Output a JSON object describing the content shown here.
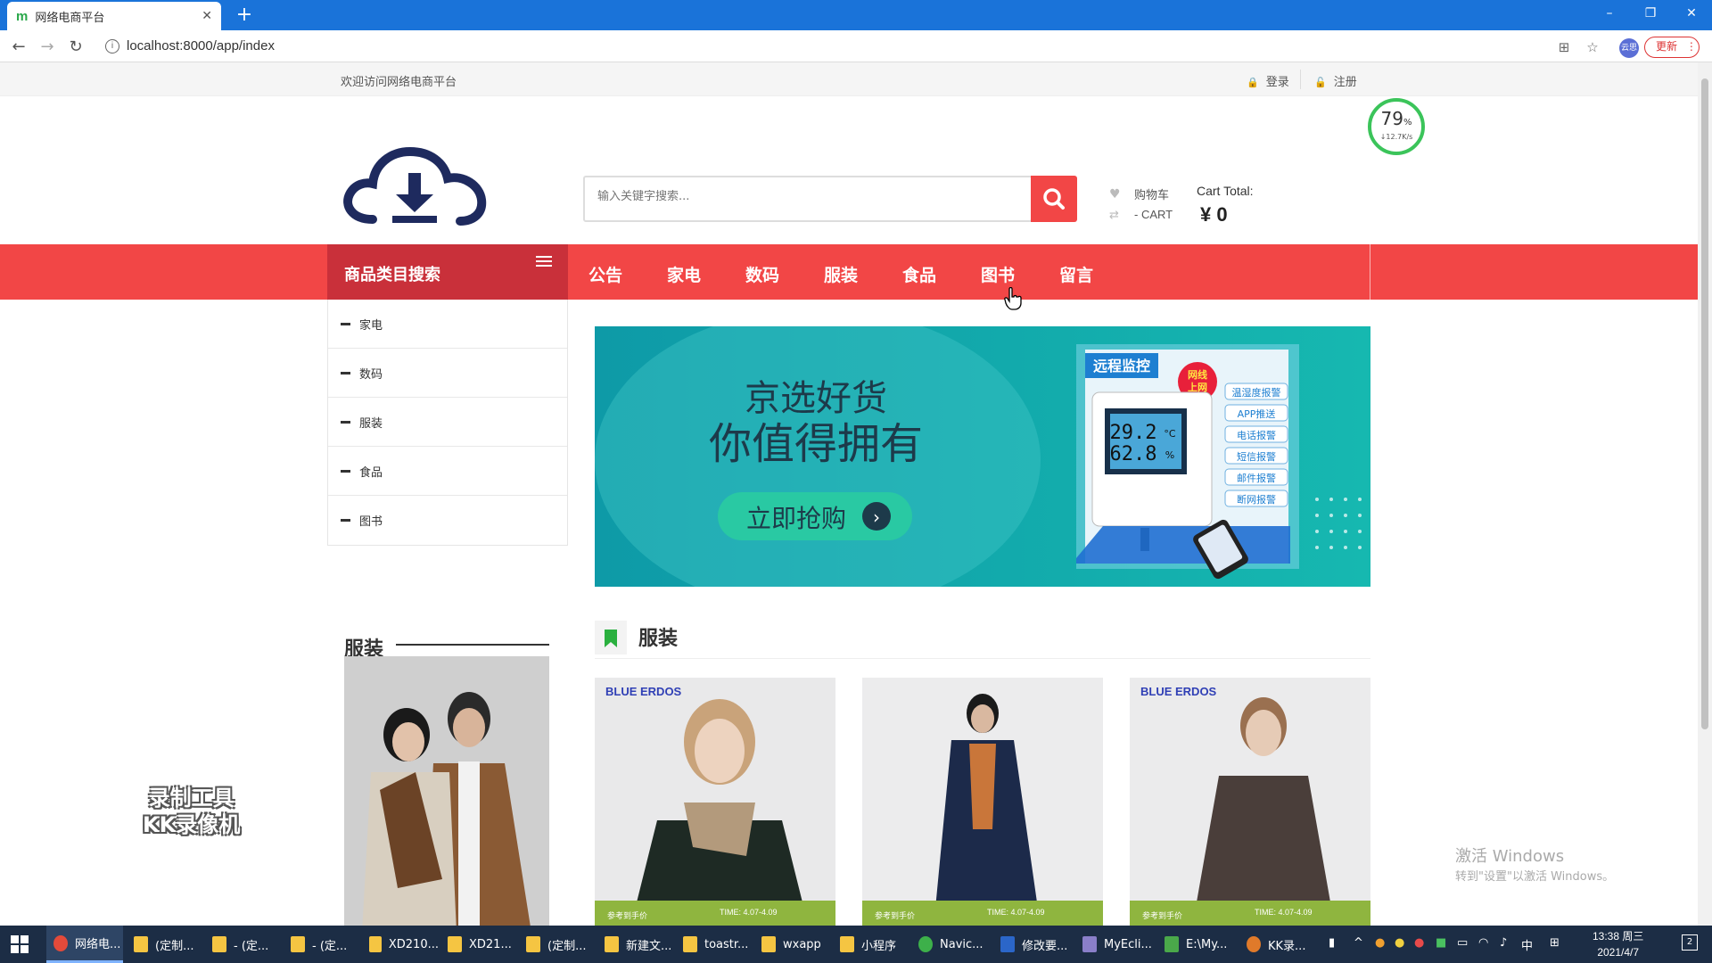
{
  "browser": {
    "tab_title": "网络电商平台",
    "tab_favicon": "m",
    "new_tab": "+",
    "url": "localhost:8000/app/index",
    "update_label": "更新",
    "profile_text": "云思",
    "window_controls": {
      "minimize": "–",
      "restore": "❐",
      "close": "✕"
    }
  },
  "topbar": {
    "welcome": "欢迎访问网络电商平台",
    "login": "登录",
    "register": "注册"
  },
  "speed_widget": {
    "percent": "79",
    "percent_unit": "%",
    "rate": "↓12.7K/s"
  },
  "search": {
    "placeholder": "输入关键字搜索..."
  },
  "cart": {
    "label": "购物车",
    "label_en": "- CART",
    "total_label": "Cart Total:",
    "total": "¥ 0"
  },
  "category_header": "商品类目搜索",
  "nav": [
    "公告",
    "家电",
    "数码",
    "服装",
    "食品",
    "图书",
    "留言"
  ],
  "categories": [
    "家电",
    "数码",
    "服装",
    "食品",
    "图书"
  ],
  "banner": {
    "headline1": "京选好货",
    "headline2": "你值得拥有",
    "cta": "立即抢购",
    "tag": "远程监控",
    "tag2a": "网线",
    "tag2b": "上网",
    "reading1": "29.2",
    "reading1_unit": "°C",
    "reading2": "62.8",
    "reading2_unit": "%",
    "features": [
      "温湿度报警",
      "APP推送",
      "电话报警",
      "短信报警",
      "邮件报警",
      "断网报警"
    ]
  },
  "section": {
    "title": "服装"
  },
  "sidebar_section": {
    "title": "服装"
  },
  "products": [
    {
      "brand": "BLUE ERDOS",
      "price_label": "参考到手价",
      "time": "TIME: 4.07-4.09"
    },
    {
      "brand": "",
      "price_label": "参考到手价",
      "time": "TIME: 4.07-4.09"
    },
    {
      "brand": "BLUE ERDOS",
      "price_label": "参考到手价",
      "time": "TIME: 4.07-4.09"
    }
  ],
  "watermark": {
    "line1": "录制工具",
    "line2": "KK录像机"
  },
  "activation": {
    "title": "激活 Windows",
    "subtitle": "转到\"设置\"以激活 Windows。"
  },
  "taskbar": {
    "items": [
      "网络电...",
      "(定制...",
      "- (定...",
      "- (定...",
      "XD210...",
      "XD21...",
      "(定制...",
      "新建文...",
      "toastr...",
      "wxapp",
      "小程序",
      "Navic...",
      "修改要...",
      "MyEcli...",
      "E:\\My...",
      "KK录..."
    ],
    "ime": "中",
    "time": "13:38 周三",
    "date": "2021/4/7",
    "notification_count": "2"
  }
}
